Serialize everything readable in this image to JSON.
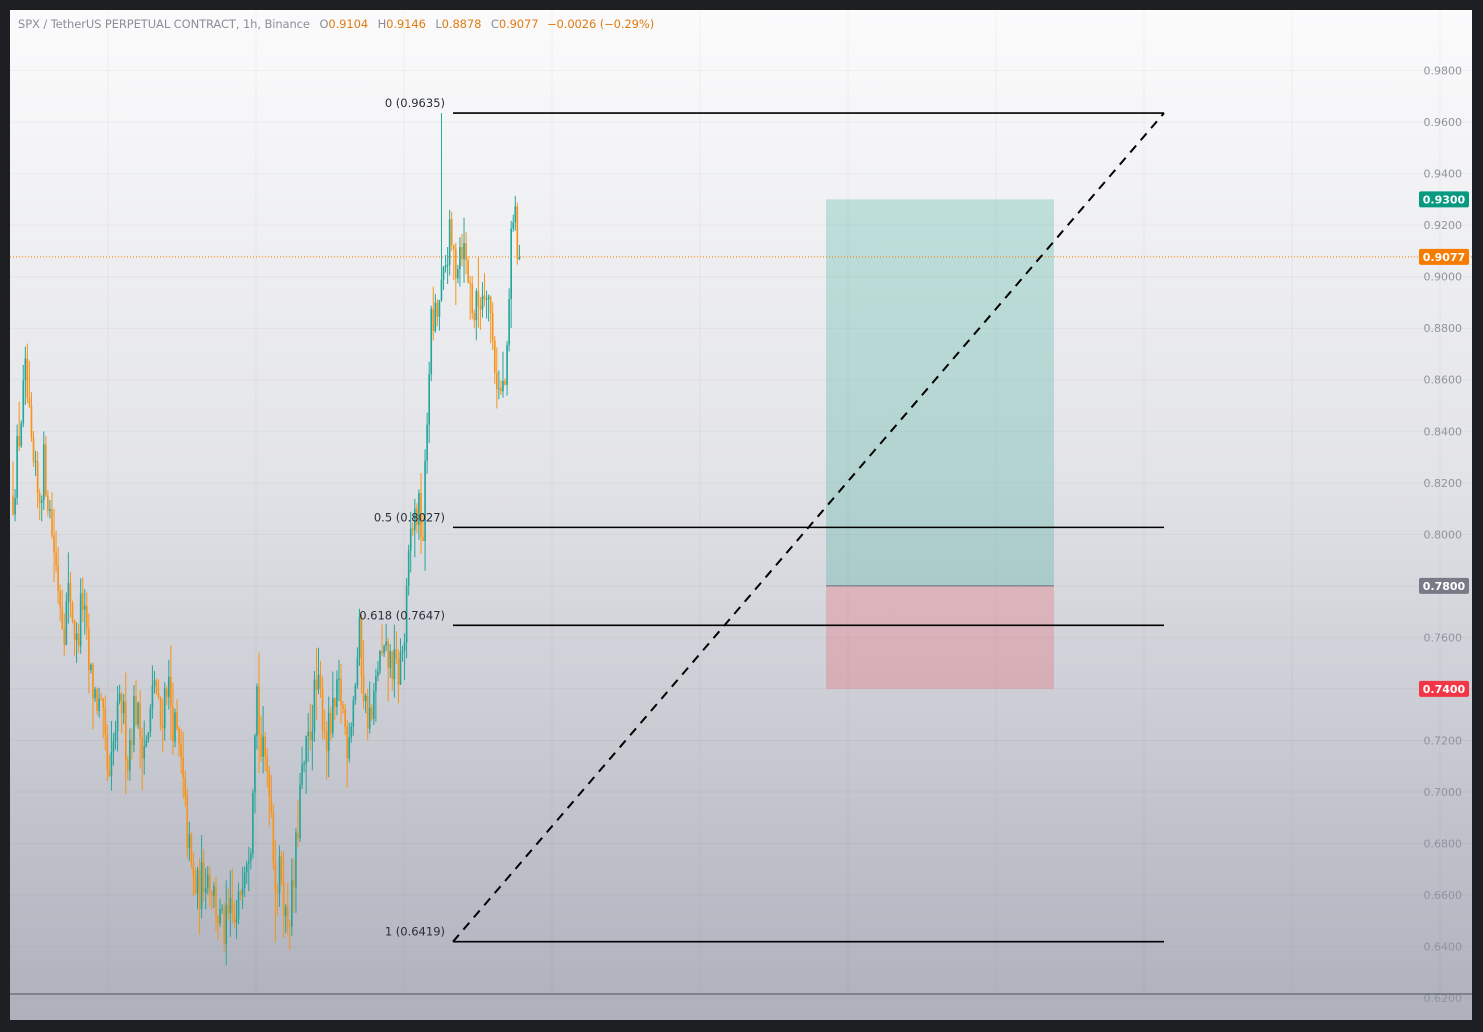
{
  "legend": {
    "symbol": "SPX / TetherUS PERPETUAL CONTRACT, 1h, Binance",
    "open_key": "O",
    "open": "0.9104",
    "high_key": "H",
    "high": "0.9146",
    "low_key": "L",
    "low": "0.8878",
    "close_key": "C",
    "close": "0.9077",
    "change": "−0.0026 (−0.29%)"
  },
  "colors": {
    "up": "#26a69a",
    "down": "#f7931a",
    "last_price": "#f57c00",
    "target": "#089981",
    "entry": "#787b86",
    "stop": "#f23645",
    "fib_line": "#000000"
  },
  "chart_data": {
    "type": "candlestick",
    "title": "SPX / TetherUS PERPETUAL CONTRACT, 1h, Binance",
    "xlabel": "",
    "ylabel": "",
    "ylim": [
      0.6216,
      1.0035
    ],
    "grid": true,
    "y_ticks": [
      "0.9800",
      "0.9600",
      "0.9400",
      "0.9200",
      "0.9000",
      "0.8800",
      "0.8600",
      "0.8400",
      "0.8200",
      "0.8000",
      "0.7800",
      "0.7600",
      "0.7400",
      "0.7200",
      "0.7000",
      "0.6800",
      "0.6600",
      "0.6400",
      "0.6200"
    ],
    "last_price": 0.9077,
    "candles_shown": 248,
    "fib_levels": [
      {
        "label": "0 (0.9635)",
        "value": 0.9635
      },
      {
        "label": "0.5 (0.8027)",
        "value": 0.8027
      },
      {
        "label": "0.618 (0.7647)",
        "value": 0.7647
      },
      {
        "label": "1 (0.6419)",
        "value": 0.6419
      }
    ],
    "position": {
      "type": "long",
      "target": 0.93,
      "entry": 0.78,
      "stop": 0.74
    },
    "price_badges": [
      {
        "label": "0.9300",
        "value": 0.93,
        "role": "target"
      },
      {
        "label": "0.9077",
        "value": 0.9077,
        "role": "last_price"
      },
      {
        "label": "0.7800",
        "value": 0.78,
        "role": "entry"
      },
      {
        "label": "0.7400",
        "value": 0.74,
        "role": "stop"
      }
    ],
    "path_anchors": [
      [
        0,
        0.815
      ],
      [
        5,
        0.842
      ],
      [
        9,
        0.862
      ],
      [
        13,
        0.83
      ],
      [
        18,
        0.812
      ],
      [
        22,
        0.828
      ],
      [
        27,
        0.804
      ],
      [
        31,
        0.785
      ],
      [
        36,
        0.765
      ],
      [
        40,
        0.779
      ],
      [
        45,
        0.756
      ],
      [
        49,
        0.776
      ],
      [
        54,
        0.745
      ],
      [
        58,
        0.738
      ],
      [
        63,
        0.728
      ],
      [
        68,
        0.7
      ],
      [
        72,
        0.723
      ],
      [
        77,
        0.735
      ],
      [
        81,
        0.713
      ],
      [
        86,
        0.735
      ],
      [
        90,
        0.723
      ],
      [
        95,
        0.717
      ],
      [
        100,
        0.745
      ],
      [
        104,
        0.725
      ],
      [
        109,
        0.745
      ],
      [
        113,
        0.728
      ],
      [
        118,
        0.714
      ],
      [
        122,
        0.69
      ],
      [
        127,
        0.665
      ],
      [
        131,
        0.661
      ],
      [
        136,
        0.67
      ],
      [
        140,
        0.666
      ],
      [
        145,
        0.652
      ],
      [
        149,
        0.645
      ],
      [
        154,
        0.652
      ],
      [
        158,
        0.647
      ],
      [
        163,
        0.675
      ],
      [
        168,
        0.683
      ],
      [
        172,
        0.745
      ],
      [
        175,
        0.715
      ],
      [
        181,
        0.708
      ],
      [
        186,
        0.662
      ],
      [
        190,
        0.67
      ],
      [
        193,
        0.649
      ],
      [
        198,
        0.66
      ],
      [
        203,
        0.7
      ],
      [
        209,
        0.72
      ],
      [
        214,
        0.74
      ],
      [
        218,
        0.735
      ],
      [
        222,
        0.72
      ],
      [
        227,
        0.73
      ],
      [
        231,
        0.74
      ],
      [
        236,
        0.72
      ],
      [
        240,
        0.733
      ],
      [
        245,
        0.76
      ],
      [
        249,
        0.733
      ],
      [
        254,
        0.727
      ],
      [
        258,
        0.75
      ],
      [
        263,
        0.751
      ],
      [
        268,
        0.75
      ],
      [
        272,
        0.745
      ],
      [
        277,
        0.76
      ],
      [
        281,
        0.8
      ],
      [
        286,
        0.81
      ],
      [
        290,
        0.8
      ],
      [
        295,
        0.88
      ],
      [
        299,
        0.883
      ],
      [
        304,
        0.895
      ],
      [
        308,
        0.915
      ],
      [
        313,
        0.905
      ],
      [
        317,
        0.915
      ],
      [
        322,
        0.9
      ],
      [
        326,
        0.885
      ],
      [
        331,
        0.893
      ],
      [
        335,
        0.9
      ],
      [
        340,
        0.87
      ],
      [
        344,
        0.853
      ],
      [
        349,
        0.86
      ],
      [
        353,
        0.928
      ],
      [
        358,
        0.9077
      ]
    ]
  }
}
